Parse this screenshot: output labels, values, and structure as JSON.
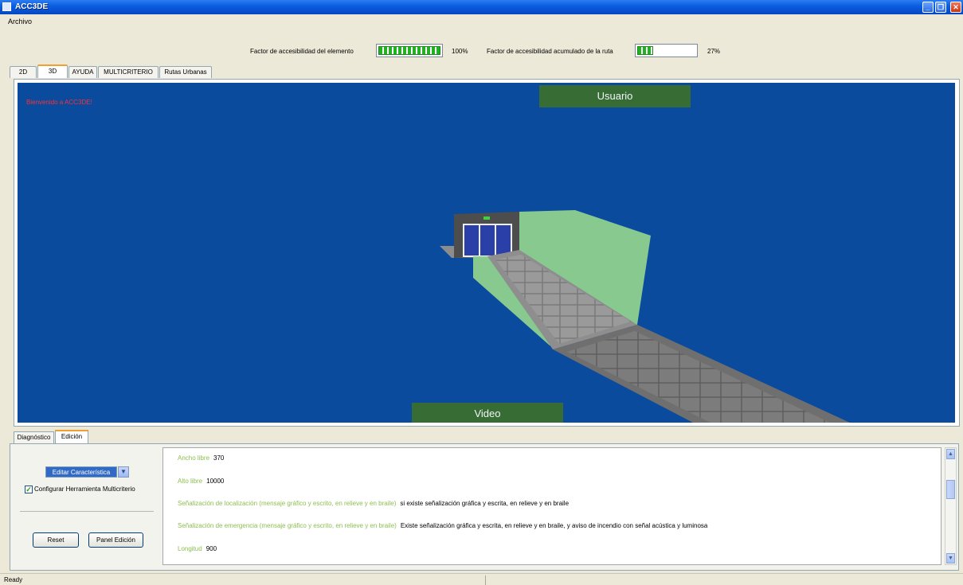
{
  "window": {
    "title": "ACC3DE"
  },
  "menu": {
    "items": [
      "Archivo"
    ]
  },
  "factors": {
    "element_label": "Factor de accesibilidad del elemento",
    "element_value": 1.0,
    "element_pct": "100%",
    "route_label": "Factor de accesibilidad acumulado de la ruta",
    "route_value": 0.27,
    "route_pct": "27%",
    "bar_color": "#23b023"
  },
  "tabs": {
    "top": [
      "2D",
      "3D",
      "AYUDA",
      "MULTICRITERIO",
      "Rutas Urbanas"
    ],
    "top_active": "3D",
    "bottom": [
      "Diagnóstico",
      "Edición"
    ],
    "bottom_active": "Edición"
  },
  "viewport": {
    "welcome": "Bienvenido a ACC3DE!",
    "user_button": "Usuario",
    "video_button": "Video",
    "background_color": "#0a4b9e"
  },
  "edit_panel": {
    "select_value": "Editar Característica",
    "checkbox_label": "Configurar Herramienta Multicriterio",
    "checkbox_checked": true,
    "reset_label": "Reset",
    "panel_label": "Panel Edición"
  },
  "properties": [
    {
      "key": "Ancho libre",
      "value": "370"
    },
    {
      "key": "Alto libre",
      "value": "10000"
    },
    {
      "key": "Señalización de localización (mensaje gráfico y escrito, en relieve y en braile)",
      "value": "si existe señalización gráfica y escrita, en relieve y en braile"
    },
    {
      "key": "Señalización de emergencia (mensaje gráfico y escrito, en relieve y en braile)",
      "value": "Existe señalización gráfica y escrita, en relieve y en braile, y aviso de incendio con señal acústica y luminosa"
    },
    {
      "key": "Longitud",
      "value": "900"
    }
  ],
  "status": {
    "text": "Ready"
  }
}
